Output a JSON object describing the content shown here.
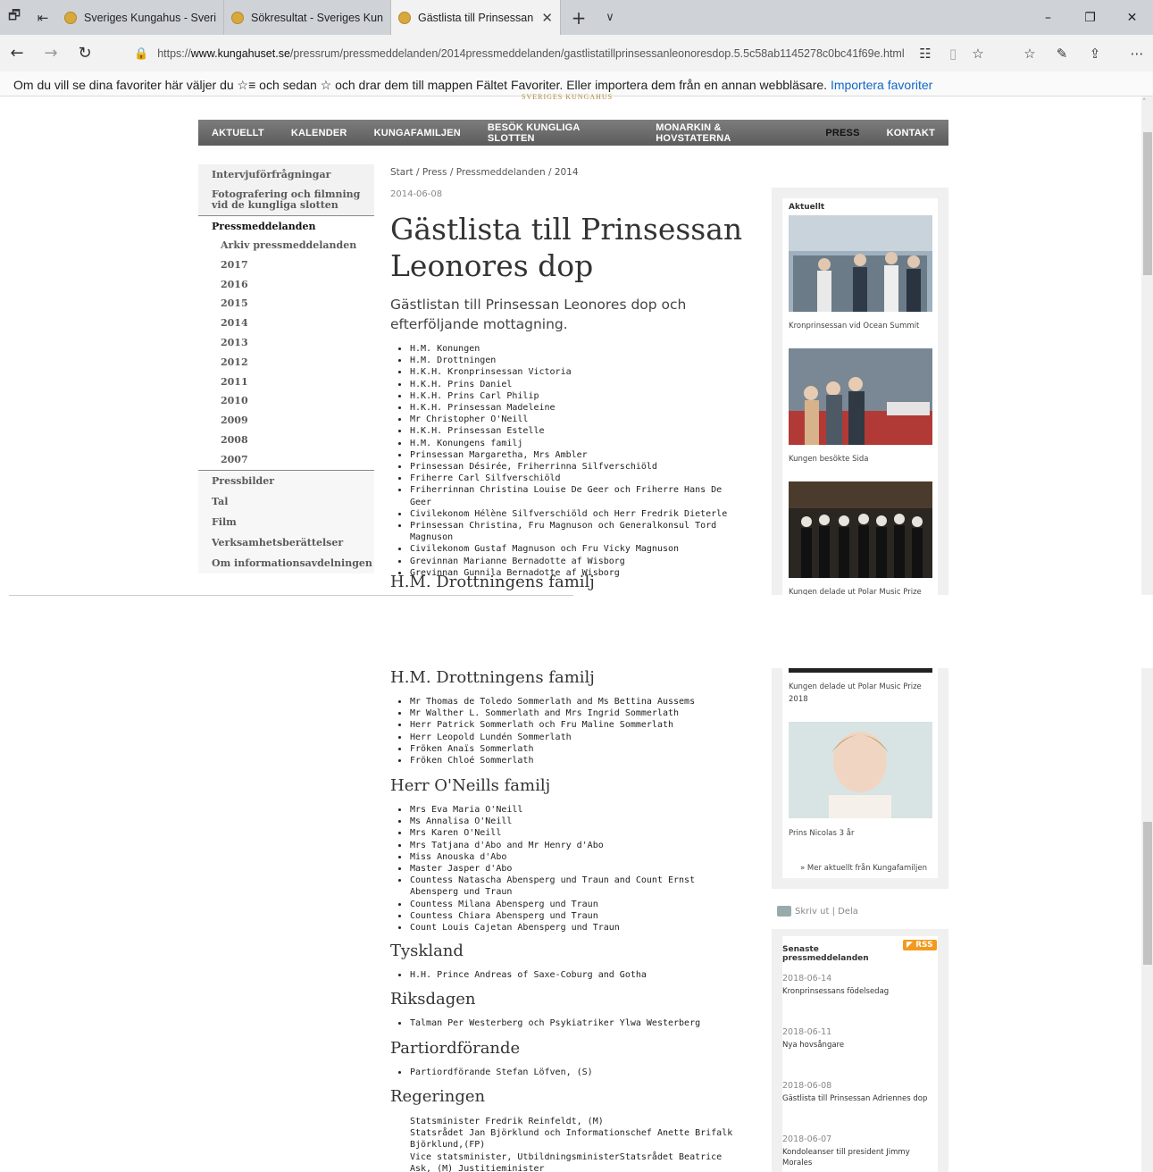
{
  "browser": {
    "tabs": [
      {
        "label": "Sveriges Kungahus - Sverige",
        "active": false
      },
      {
        "label": "Sökresultat - Sveriges Kung",
        "active": false
      },
      {
        "label": "Gästlista till Prinsessan L",
        "active": true
      }
    ],
    "url_prefix": "https://",
    "url_domain": "www.kungahuset.se",
    "url_path": "/pressrum/pressmeddelanden/2014pressmeddelanden/gastlistatillprinsessanleonoresdop.5.5c58ab1145278c0bc41f69e.html",
    "favorites_text": "Om du vill se dina favoriter här väljer du ☆≡ och sedan ☆ och drar dem till mappen Fältet Favoriter. Eller importera dem från en annan webbläsare.",
    "favorites_link": "Importera favoriter"
  },
  "site": {
    "logo": "SVERIGES KUNGAHUS",
    "nav": [
      "AKTUELLT",
      "KALENDER",
      "KUNGAFAMILJEN",
      "BESÖK KUNGLIGA SLOTTEN",
      "MONARKIN & HOVSTATERNA",
      "PRESS",
      "KONTAKT"
    ],
    "nav_active": "PRESS"
  },
  "leftnav": {
    "item1": "Intervjuförfrågningar",
    "item2": "Fotografering och filmning vid de kungliga slotten",
    "active": "Pressmeddelanden",
    "archive": "Arkiv pressmeddelanden",
    "years": [
      "2017",
      "2016",
      "2015",
      "2014",
      "2013",
      "2012",
      "2011",
      "2010",
      "2009",
      "2008",
      "2007"
    ],
    "bottom": [
      "Pressbilder",
      "Tal",
      "Film",
      "Verksamhetsberättelser",
      "Om informationsavdelningen"
    ]
  },
  "article": {
    "breadcrumb": "Start / Press / Pressmeddelanden / 2014",
    "date": "2014-06-08",
    "title": "Gästlista till Prinsessan Leonores dop",
    "ingress": "Gästlistan till Prinsessan Leonores dop och efterföljande mottagning.",
    "main_list": [
      "H.M. Konungen",
      "H.M. Drottningen",
      "H.K.H. Kronprinsessan Victoria",
      "H.K.H. Prins Daniel",
      "H.K.H. Prins Carl Philip",
      "H.K.H. Prinsessan Madeleine",
      "Mr Christopher O'Neill",
      "H.K.H. Prinsessan Estelle",
      "H.M. Konungens familj",
      "Prinsessan Margaretha, Mrs Ambler",
      "Prinsessan Désirée, Friherrinna Silfverschiöld",
      "Friherre Carl Silfverschiöld",
      "Friherrinnan Christina Louise De Geer och Friherre Hans De Geer",
      "Civilekonom Hélène Silfverschiöld och Herr Fredrik Dieterle",
      "Prinsessan Christina, Fru Magnuson och Generalkonsul Tord Magnuson",
      "Civilekonom Gustaf Magnuson och Fru Vicky Magnuson",
      "Grevinnan Marianne Bernadotte af Wisborg",
      "Grevinnan Gunnila Bernadotte af Wisborg"
    ],
    "sec_queen": "H.M. Drottningens familj",
    "queen_list": [
      "Mr Thomas de Toledo Sommerlath and Ms Bettina Aussems",
      "Mr Walther L. Sommerlath and Mrs Ingrid Sommerlath",
      "Herr Patrick Sommerlath och Fru Maline Sommerlath",
      "Herr Leopold Lundén Sommerlath",
      "Fröken Anaïs Sommerlath",
      "Fröken Chloé Sommerlath"
    ],
    "sec_oneill": "Herr O'Neills familj",
    "oneill_list": [
      "Mrs Eva Maria O'Neill",
      "Ms Annalisa O'Neill",
      "Mrs Karen O'Neill",
      "Mrs Tatjana d'Abo and Mr Henry d'Abo",
      "Miss Anouska d'Abo",
      "Master Jasper d'Abo",
      "Countess Natascha Abensperg und Traun and Count Ernst Abensperg und Traun",
      "Countess Milana Abensperg und Traun",
      "Countess Chiara Abensperg und Traun",
      "Count Louis Cajetan Abensperg und Traun"
    ],
    "sec_tyskland": "Tyskland",
    "tyskland_list": [
      "H.H. Prince Andreas of Saxe-Coburg and Gotha"
    ],
    "sec_riksdagen": "Riksdagen",
    "riksdagen_list": [
      "Talman Per Westerberg och Psykiatriker Ylwa Westerberg"
    ],
    "sec_parti": "Partiordförande",
    "parti_list": [
      "Partiordförande Stefan Löfven, (S)"
    ],
    "sec_reg": "Regeringen",
    "reg_list": [
      "Statsminister Fredrik Reinfeldt, (M)",
      "Statsrådet Jan Björklund och Informationschef Anette Brifalk Björklund,(FP)",
      "Vice statsminister, UtbildningsministerStatsrådet Beatrice Ask, (M) Justitieminister"
    ]
  },
  "sidebar": {
    "heading": "Aktuellt",
    "captions": [
      "Kronprinsessan vid Ocean Summit",
      "Kungen besökte Sida",
      "Kungen delade ut Polar Music Prize",
      "Kungen delade ut Polar Music Prize 2018",
      "Prins Nicolas 3 år"
    ],
    "more": "» Mer aktuellt från Kungafamiljen",
    "print": "Skriv ut | Dela",
    "press_heading": "Senaste pressmeddelanden",
    "rss": "RSS",
    "press": [
      {
        "date": "2018-06-14",
        "text": "Kronprinsessans födelsedag"
      },
      {
        "date": "2018-06-11",
        "text": "Nya hovsångare"
      },
      {
        "date": "2018-06-08",
        "text": "Gästlista till Prinsessan Adriennes dop"
      },
      {
        "date": "2018-06-07",
        "text": "Kondoleanser till president Jimmy Morales"
      }
    ]
  }
}
